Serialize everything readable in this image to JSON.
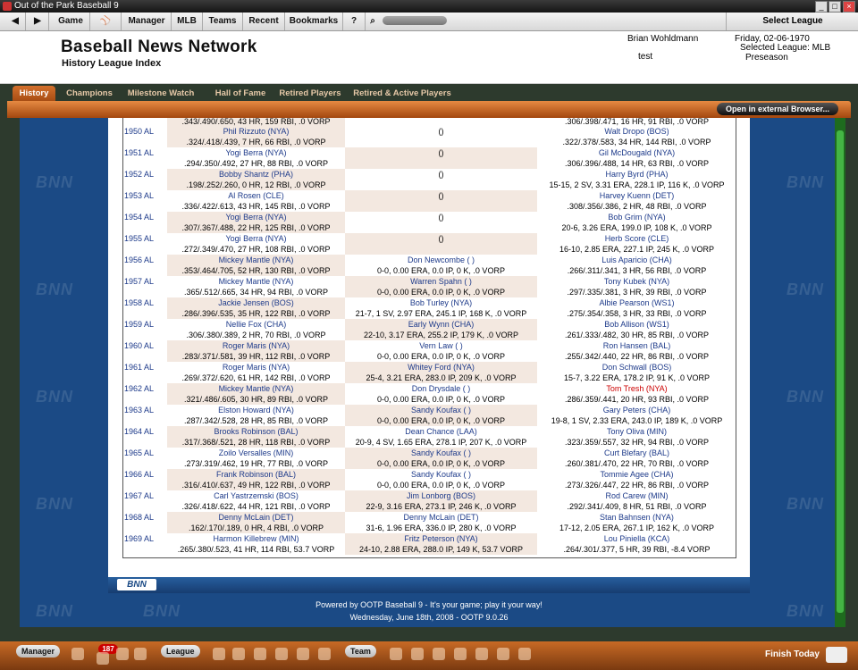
{
  "window": {
    "title": "Out of the Park Baseball 9"
  },
  "menu": {
    "items": [
      "Game",
      "Manager",
      "MLB",
      "Teams",
      "Recent",
      "Bookmarks",
      "?"
    ],
    "select_league": "Select League"
  },
  "header": {
    "title": "Baseball News Network",
    "subtitle": "History League Index",
    "user": "Brian Wohldmann",
    "user_sub": "test",
    "date": "Friday, 02-06-1970",
    "league": "Selected League: MLB",
    "phase": "Preseason"
  },
  "tabs": [
    "History",
    "Champions",
    "Milestone Watch",
    "Hall of Fame",
    "Retired Players",
    "Retired & Active Players"
  ],
  "external_button": "Open in external Browser...",
  "watermark": "BNN",
  "table": {
    "partial_row": {
      "c1": ".343/.490/.650, 43 HR, 159 RBI, .0 VORP",
      "c3": ".306/.398/.471, 16 HR, 91 RBI, .0 VORP"
    },
    "rows": [
      {
        "year": "1950 AL",
        "p1": "Phil Rizzuto (NYA)",
        "s1": ".324/.418/.439, 7 HR, 66 RBI, .0 VORP",
        "p2": "()",
        "s2": "",
        "p3": "Walt Dropo (BOS)",
        "s3": ".322/.378/.583, 34 HR, 144 RBI, .0 VORP"
      },
      {
        "year": "1951 AL",
        "p1": "Yogi Berra (NYA)",
        "s1": ".294/.350/.492, 27 HR, 88 RBI, .0 VORP",
        "p2": "()",
        "s2": "",
        "p3": "Gil McDougald (NYA)",
        "s3": ".306/.396/.488, 14 HR, 63 RBI, .0 VORP"
      },
      {
        "year": "1952 AL",
        "p1": "Bobby Shantz (PHA)",
        "s1": ".198/.252/.260, 0 HR, 12 RBI, .0 VORP",
        "p2": "()",
        "s2": "",
        "p3": "Harry Byrd (PHA)",
        "s3": "15-15, 2 SV, 3.31 ERA, 228.1 IP, 116 K, .0 VORP"
      },
      {
        "year": "1953 AL",
        "p1": "Al Rosen (CLE)",
        "s1": ".336/.422/.613, 43 HR, 145 RBI, .0 VORP",
        "p2": "()",
        "s2": "",
        "p3": "Harvey Kuenn (DET)",
        "s3": ".308/.356/.386, 2 HR, 48 RBI, .0 VORP"
      },
      {
        "year": "1954 AL",
        "p1": "Yogi Berra (NYA)",
        "s1": ".307/.367/.488, 22 HR, 125 RBI, .0 VORP",
        "p2": "()",
        "s2": "",
        "p3": "Bob Grim (NYA)",
        "s3": "20-6, 3.26 ERA, 199.0 IP, 108 K, .0 VORP"
      },
      {
        "year": "1955 AL",
        "p1": "Yogi Berra (NYA)",
        "s1": ".272/.349/.470, 27 HR, 108 RBI, .0 VORP",
        "p2": "()",
        "s2": "",
        "p3": "Herb Score (CLE)",
        "s3": "16-10, 2.85 ERA, 227.1 IP, 245 K, .0 VORP"
      },
      {
        "year": "1956 AL",
        "p1": "Mickey Mantle (NYA)",
        "s1": ".353/.464/.705, 52 HR, 130 RBI, .0 VORP",
        "p2": "Don Newcombe ( )",
        "s2": "0-0, 0.00 ERA, 0.0 IP, 0 K, .0 VORP",
        "p3": "Luis Aparicio (CHA)",
        "s3": ".266/.311/.341, 3 HR, 56 RBI, .0 VORP"
      },
      {
        "year": "1957 AL",
        "p1": "Mickey Mantle (NYA)",
        "s1": ".365/.512/.665, 34 HR, 94 RBI, .0 VORP",
        "p2": "Warren Spahn ( )",
        "s2": "0-0, 0.00 ERA, 0.0 IP, 0 K, .0 VORP",
        "p3": "Tony Kubek (NYA)",
        "s3": ".297/.335/.381, 3 HR, 39 RBI, .0 VORP"
      },
      {
        "year": "1958 AL",
        "p1": "Jackie Jensen (BOS)",
        "s1": ".286/.396/.535, 35 HR, 122 RBI, .0 VORP",
        "p2": "Bob Turley (NYA)",
        "s2": "21-7, 1 SV, 2.97 ERA, 245.1 IP, 168 K, .0 VORP",
        "p3": "Albie Pearson (WS1)",
        "s3": ".275/.354/.358, 3 HR, 33 RBI, .0 VORP"
      },
      {
        "year": "1959 AL",
        "p1": "Nellie Fox (CHA)",
        "s1": ".306/.380/.389, 2 HR, 70 RBI, .0 VORP",
        "p2": "Early Wynn (CHA)",
        "s2": "22-10, 3.17 ERA, 255.2 IP, 179 K, .0 VORP",
        "p3": "Bob Allison (WS1)",
        "s3": ".261/.333/.482, 30 HR, 85 RBI, .0 VORP"
      },
      {
        "year": "1960 AL",
        "p1": "Roger Maris (NYA)",
        "s1": ".283/.371/.581, 39 HR, 112 RBI, .0 VORP",
        "p2": "Vern Law ( )",
        "s2": "0-0, 0.00 ERA, 0.0 IP, 0 K, .0 VORP",
        "p3": "Ron Hansen (BAL)",
        "s3": ".255/.342/.440, 22 HR, 86 RBI, .0 VORP"
      },
      {
        "year": "1961 AL",
        "p1": "Roger Maris (NYA)",
        "s1": ".269/.372/.620, 61 HR, 142 RBI, .0 VORP",
        "p2": "Whitey Ford (NYA)",
        "s2": "25-4, 3.21 ERA, 283.0 IP, 209 K, .0 VORP",
        "p3": "Don Schwall (BOS)",
        "s3": "15-7, 3.22 ERA, 178.2 IP, 91 K, .0 VORP"
      },
      {
        "year": "1962 AL",
        "p1": "Mickey Mantle (NYA)",
        "s1": ".321/.486/.605, 30 HR, 89 RBI, .0 VORP",
        "p2": "Don Drysdale ( )",
        "s2": "0-0, 0.00 ERA, 0.0 IP, 0 K, .0 VORP",
        "p3": "Tom Tresh (NYA)",
        "s3": ".286/.359/.441, 20 HR, 93 RBI, .0 VORP",
        "p3red": true
      },
      {
        "year": "1963 AL",
        "p1": "Elston Howard (NYA)",
        "s1": ".287/.342/.528, 28 HR, 85 RBI, .0 VORP",
        "p2": "Sandy Koufax ( )",
        "s2": "0-0, 0.00 ERA, 0.0 IP, 0 K, .0 VORP",
        "p3": "Gary Peters (CHA)",
        "s3": "19-8, 1 SV, 2.33 ERA, 243.0 IP, 189 K, .0 VORP"
      },
      {
        "year": "1964 AL",
        "p1": "Brooks Robinson (BAL)",
        "s1": ".317/.368/.521, 28 HR, 118 RBI, .0 VORP",
        "p2": "Dean Chance (LAA)",
        "s2": "20-9, 4 SV, 1.65 ERA, 278.1 IP, 207 K, .0 VORP",
        "p3": "Tony Oliva (MIN)",
        "s3": ".323/.359/.557, 32 HR, 94 RBI, .0 VORP"
      },
      {
        "year": "1965 AL",
        "p1": "Zoilo Versalles (MIN)",
        "s1": ".273/.319/.462, 19 HR, 77 RBI, .0 VORP",
        "p2": "Sandy Koufax ( )",
        "s2": "0-0, 0.00 ERA, 0.0 IP, 0 K, .0 VORP",
        "p3": "Curt Blefary (BAL)",
        "s3": ".260/.381/.470, 22 HR, 70 RBI, .0 VORP"
      },
      {
        "year": "1966 AL",
        "p1": "Frank Robinson (BAL)",
        "s1": ".316/.410/.637, 49 HR, 122 RBI, .0 VORP",
        "p2": "Sandy Koufax ( )",
        "s2": "0-0, 0.00 ERA, 0.0 IP, 0 K, .0 VORP",
        "p3": "Tommie Agee (CHA)",
        "s3": ".273/.326/.447, 22 HR, 86 RBI, .0 VORP"
      },
      {
        "year": "1967 AL",
        "p1": "Carl Yastrzemski (BOS)",
        "s1": ".326/.418/.622, 44 HR, 121 RBI, .0 VORP",
        "p2": "Jim Lonborg (BOS)",
        "s2": "22-9, 3.16 ERA, 273.1 IP, 246 K, .0 VORP",
        "p3": "Rod Carew (MIN)",
        "s3": ".292/.341/.409, 8 HR, 51 RBI, .0 VORP"
      },
      {
        "year": "1968 AL",
        "p1": "Denny McLain (DET)",
        "s1": ".162/.170/.189, 0 HR, 4 RBI, .0 VORP",
        "p2": "Denny McLain (DET)",
        "s2": "31-6, 1.96 ERA, 336.0 IP, 280 K, .0 VORP",
        "p3": "Stan Bahnsen (NYA)",
        "s3": "17-12, 2.05 ERA, 267.1 IP, 162 K, .0 VORP"
      },
      {
        "year": "1969 AL",
        "p1": "Harmon Killebrew (MIN)",
        "s1": ".265/.380/.523, 41 HR, 114 RBI, 53.7 VORP",
        "p2": "Fritz Peterson (NYA)",
        "s2": "24-10, 2.88 ERA, 288.0 IP, 149 K, 53.7 VORP",
        "p3": "Lou Piniella (KCA)",
        "s3": ".264/.301/.377, 5 HR, 39 RBI, -8.4 VORP"
      }
    ]
  },
  "logo": "BNN",
  "footer": {
    "line1": "Powered by OOTP Baseball 9 - It's your game; play it your way!",
    "line2": "Wednesday, June 18th, 2008 - OOTP 9.0.26"
  },
  "bottombar": {
    "manager": "Manager",
    "league": "League",
    "team": "Team",
    "badge": "187",
    "finish": "Finish Today"
  }
}
